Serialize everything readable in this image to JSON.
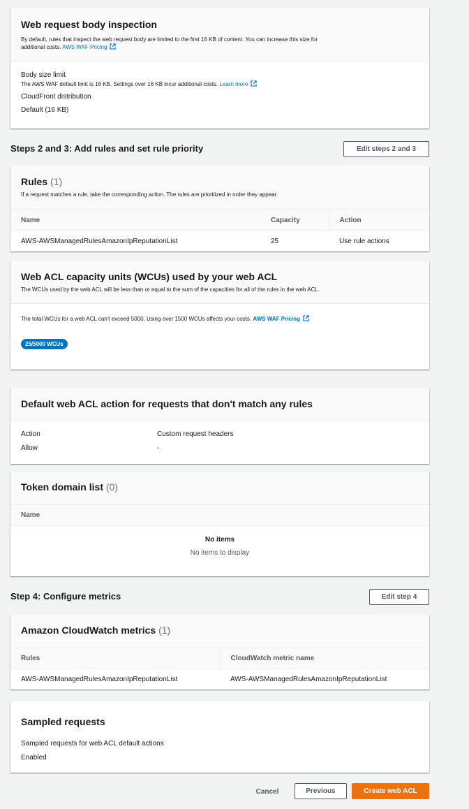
{
  "body_inspection": {
    "title": "Web request body inspection",
    "description": "By default, rules that inspect the web request body are limited to the first 16 KB of content. You can increase this size for additional costs.",
    "pricing_link": "AWS WAF Pricing",
    "size_limit_label": "Body size limit",
    "size_limit_note": "The AWS WAF default limit is 16 KB. Settings over 16 KB incur additional costs.",
    "learn_more": "Learn more",
    "distribution_label": "CloudFront distribution",
    "distribution_value": "Default (16 KB)"
  },
  "steps_2_3": {
    "title": "Steps 2 and 3: Add rules and set rule priority",
    "edit_button": "Edit steps 2 and 3"
  },
  "rules": {
    "title": "Rules",
    "count": "(1)",
    "description": "If a request matches a rule, take the corresponding action. The rules are prioritized in order they appear.",
    "columns": [
      "Name",
      "Capacity",
      "Action"
    ],
    "rows": [
      {
        "name": "AWS-AWSManagedRulesAmazonIpReputationList",
        "capacity": "25",
        "action": "Use rule actions"
      }
    ]
  },
  "wcu": {
    "title": "Web ACL capacity units (WCUs) used by your web ACL",
    "description": "The WCUs used by the web ACL will be less than or equal to the sum of the capacities for all of the rules in the web ACL.",
    "note": "The total WCUs for a web ACL can't exceed 5000. Using over 1500 WCUs affects your costs.",
    "pricing_link": "AWS WAF Pricing",
    "badge": "25/5000 WCUs"
  },
  "default_action": {
    "title": "Default web ACL action for requests that don't match any rules",
    "action_label": "Action",
    "action_value": "Allow",
    "headers_label": "Custom request headers",
    "headers_value": "-"
  },
  "token_domain": {
    "title": "Token domain list",
    "count": "(0)",
    "column": "Name",
    "empty_title": "No items",
    "empty_desc": "No items to display"
  },
  "step_4": {
    "title": "Step 4: Configure metrics",
    "edit_button": "Edit step 4"
  },
  "cloudwatch": {
    "title": "Amazon CloudWatch metrics",
    "count": "(1)",
    "columns": [
      "Rules",
      "CloudWatch metric name"
    ],
    "rows": [
      {
        "rule": "AWS-AWSManagedRulesAmazonIpReputationList",
        "metric": "AWS-AWSManagedRulesAmazonIpReputationList"
      }
    ]
  },
  "sampled": {
    "title": "Sampled requests",
    "label": "Sampled requests for web ACL default actions",
    "value": "Enabled"
  },
  "footer": {
    "cancel": "Cancel",
    "previous": "Previous",
    "create": "Create web ACL"
  },
  "colors": {
    "link": "#0073bb",
    "primary_button": "#ec7211",
    "badge": "#0073bb",
    "background": "#f2f3f3"
  },
  "icons": [
    "external-link-icon"
  ]
}
